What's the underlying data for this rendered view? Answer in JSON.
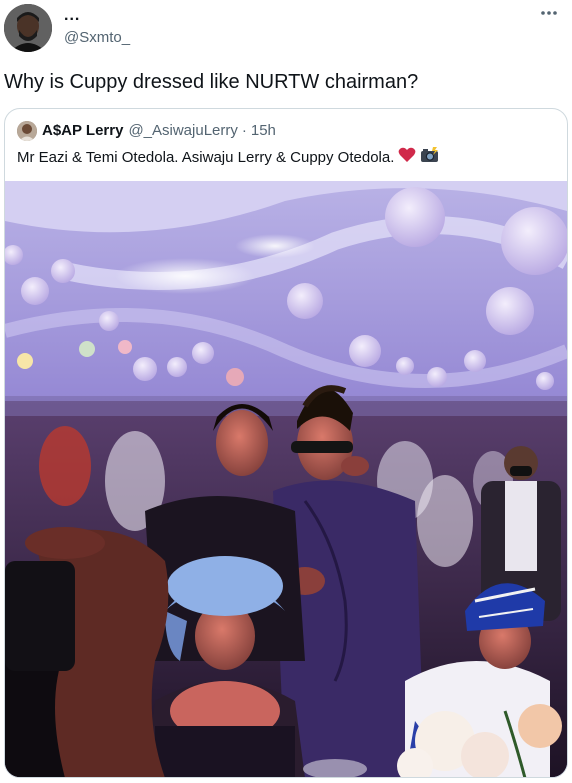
{
  "tweet": {
    "display_name": "...",
    "handle": "@Sxmto_",
    "text": "Why is Cuppy dressed like NURTW chairman?",
    "more_label": "···"
  },
  "quoted": {
    "name": "A$AP Lerry",
    "handle": "@_AsiwajuLerry",
    "separator": "·",
    "time": "15h",
    "text": "Mr Eazi & Temi Otedola. Asiwaju Lerry & Cuppy Otedola.",
    "emojis": [
      "heart-icon",
      "camera-flash-icon"
    ]
  },
  "colors": {
    "text_primary": "#0f1419",
    "text_secondary": "#536471",
    "border": "#cfd9de",
    "heart": "#d0294a"
  }
}
